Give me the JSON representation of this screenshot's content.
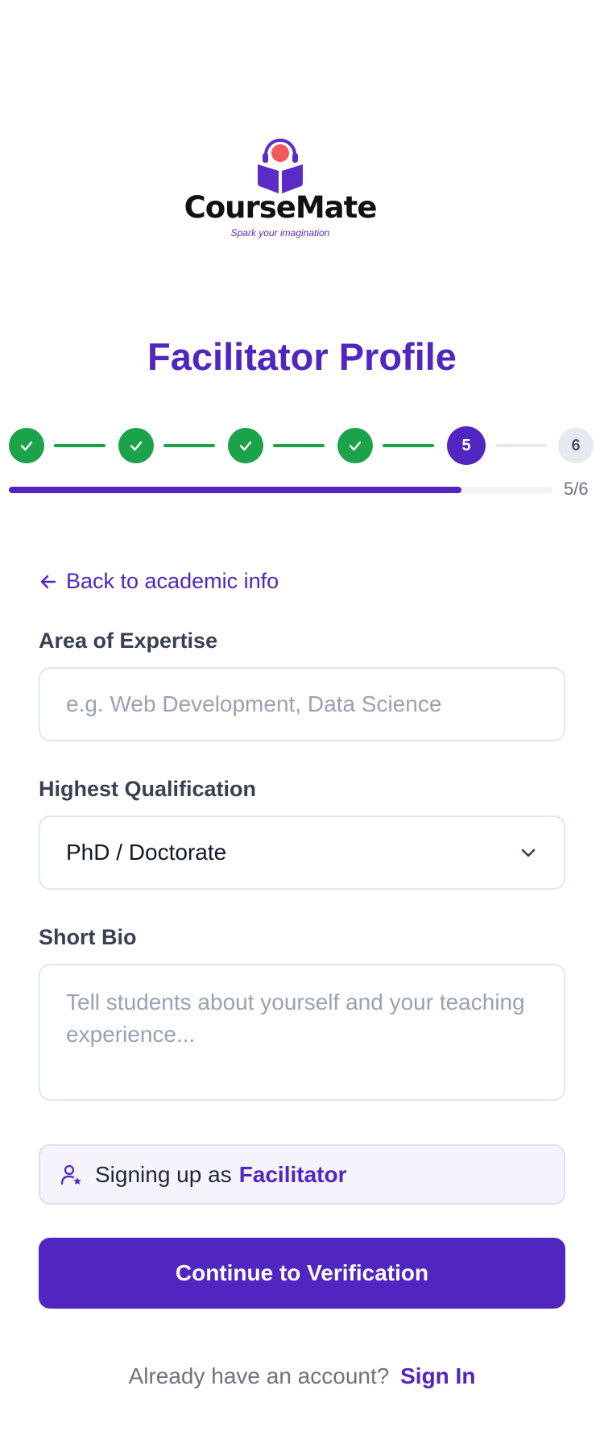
{
  "brand": {
    "name": "CourseMate",
    "tagline": "Spark your imagination",
    "colors": {
      "primary": "#5125c0",
      "success": "#1aa34a",
      "logo_accent": "#f05a5a"
    }
  },
  "page_title": "Facilitator Profile",
  "stepper": {
    "steps": [
      {
        "label": "",
        "state": "done",
        "icon": "check-icon"
      },
      {
        "label": "",
        "state": "done",
        "icon": "check-icon"
      },
      {
        "label": "",
        "state": "done",
        "icon": "check-icon"
      },
      {
        "label": "",
        "state": "done",
        "icon": "check-icon"
      },
      {
        "label": "5",
        "state": "current"
      },
      {
        "label": "6",
        "state": "todo"
      }
    ],
    "progress_fraction": 0.8333,
    "progress_text": "5/6"
  },
  "back_link": {
    "label": "Back to academic info",
    "icon": "arrow-left-icon"
  },
  "form": {
    "expertise": {
      "label": "Area of Expertise",
      "placeholder": "e.g. Web Development, Data Science",
      "value": ""
    },
    "qualification": {
      "label": "Highest Qualification",
      "selected": "PhD / Doctorate",
      "icon": "chevron-down-icon"
    },
    "bio": {
      "label": "Short Bio",
      "placeholder": "Tell students about yourself and your teaching experience...",
      "value": ""
    }
  },
  "role_notice": {
    "prefix": "Signing up as",
    "role": "Facilitator",
    "icon": "user-star-icon"
  },
  "cta": {
    "label": "Continue to Verification"
  },
  "footer": {
    "prompt": "Already have an account?",
    "link": "Sign In"
  }
}
